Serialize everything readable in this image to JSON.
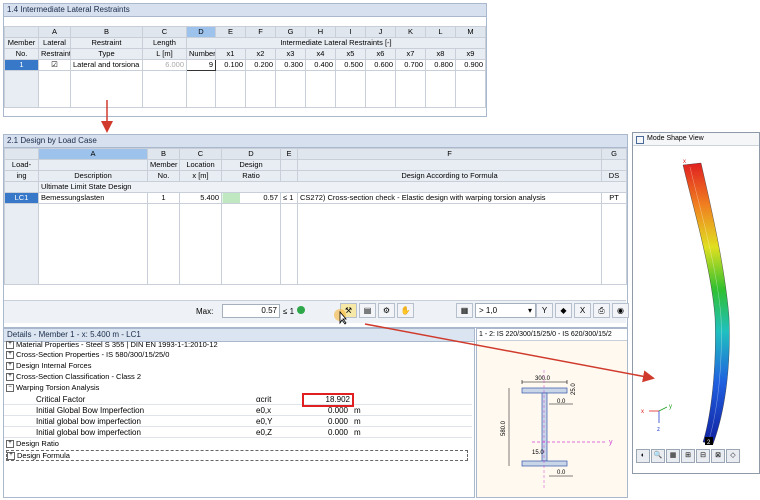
{
  "lateral": {
    "title": "1.4 Intermediate Lateral Restraints",
    "col_letters": [
      "A",
      "B",
      "C",
      "D",
      "E",
      "F",
      "G",
      "H",
      "I",
      "J",
      "K",
      "L",
      "M"
    ],
    "head1": {
      "member": "Member",
      "lateral": "Lateral",
      "restraint": "Restraint",
      "length": "Length",
      "group": "Intermediate Lateral Restraints [-]"
    },
    "head2": {
      "no": "No.",
      "restraints": "Restraints",
      "type": "Type",
      "length_unit": "L [m]",
      "number": "Number",
      "x_labels": [
        "x1",
        "x2",
        "x3",
        "x4",
        "x5",
        "x6",
        "x7",
        "x8",
        "x9"
      ]
    },
    "row": {
      "index": "1",
      "checked": "☑",
      "type": "Lateral and torsiona",
      "length": "6.000",
      "number": "9",
      "x_values": [
        "0.100",
        "0.200",
        "0.300",
        "0.400",
        "0.500",
        "0.600",
        "0.700",
        "0.800",
        "0.900"
      ]
    }
  },
  "design": {
    "title": "2.1 Design by Load Case",
    "col_letters": [
      "A",
      "B",
      "C",
      "D",
      "E",
      "F",
      "G"
    ],
    "head1": {
      "loading": "Load-",
      "member": "Member",
      "location": "Location",
      "design": "Design",
      "da": "",
      "ds": ""
    },
    "head2": {
      "loading": "ing",
      "description": "Description",
      "member_no": "No.",
      "location": "x [m]",
      "ratio": "Ratio",
      "formula": "Design According to Formula",
      "ds": "DS"
    },
    "group_label": "Ultimate Limit State Design",
    "row": {
      "lc": "LC1",
      "description": "Bemessungslasten",
      "member": "1",
      "location": "5.400",
      "ratio": "0.57",
      "le": "≤ 1",
      "formula": "CS272) Cross-section check - Elastic design with warping torsion analysis",
      "ds": "PT"
    },
    "max_label": "Max:",
    "max_value": "0.57",
    "max_le": "≤ 1",
    "combo_value": "> 1,0"
  },
  "details": {
    "title": "Details - Member 1 - x: 5.400 m - LC1",
    "items": [
      {
        "sign": "+",
        "label": "Material Properties - Steel S 355 | DIN EN 1993-1-1:2010-12"
      },
      {
        "sign": "+",
        "label": "Cross-Section Properties  -  IS 580/300/15/25/0"
      },
      {
        "sign": "+",
        "label": "Design Internal Forces"
      },
      {
        "sign": "+",
        "label": "Cross-Section Classification - Class 2"
      },
      {
        "sign": "−",
        "label": "Warping Torsion Analysis"
      }
    ],
    "sub_items": [
      {
        "label": "Critical Factor",
        "symbol": "αcrit",
        "value": "18.902",
        "unit": ""
      },
      {
        "label": "Initial Global Bow Imperfection",
        "symbol": "e0,x",
        "value": "0.000",
        "unit": "m"
      },
      {
        "label": "Initial global bow imperfection",
        "symbol": "e0,Y",
        "value": "0.000",
        "unit": "m"
      },
      {
        "label": "Initial global bow imperfection",
        "symbol": "e0,Z",
        "value": "0.000",
        "unit": "m"
      }
    ],
    "tail_items": [
      {
        "sign": "+",
        "label": "Design Ratio"
      },
      {
        "sign": "+",
        "label": "Design Formula"
      }
    ]
  },
  "section": {
    "title": "1 - 2: IS 220/300/15/25/0 - IS 620/300/15/2",
    "dims": {
      "top_width": "300.0",
      "flange": "25.0",
      "web": "0.0",
      "height": "580.0",
      "web_thk": "15.0",
      "bottom": "0.0"
    },
    "axis_y": "y",
    "axis_z": "z"
  },
  "mode_view": {
    "title": "Mode Shape View",
    "axis_x": "x",
    "axis_y": "y",
    "axis_z": "z",
    "node": "2"
  },
  "colors": {
    "accent": "#3778c9",
    "arrow": "#d03a2c",
    "highlight": "#e02020",
    "panel": "#d6e0ee"
  }
}
